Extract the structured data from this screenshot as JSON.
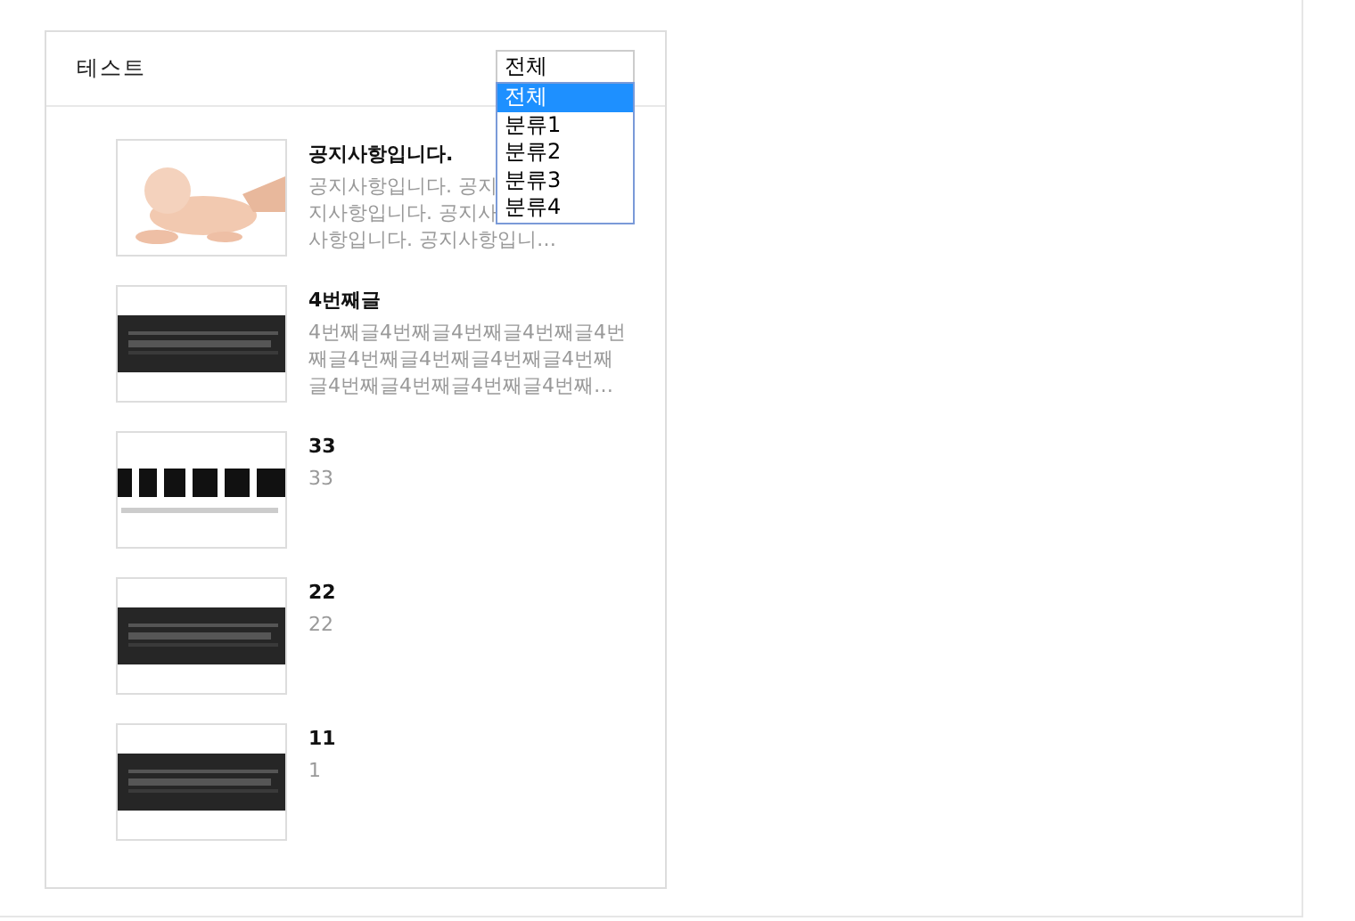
{
  "board": {
    "title": "테스트",
    "category_select": {
      "value": "전체",
      "expanded": true,
      "options": [
        {
          "label": "전체",
          "selected": true
        },
        {
          "label": "분류1",
          "selected": false
        },
        {
          "label": "분류2",
          "selected": false
        },
        {
          "label": "분류3",
          "selected": false
        },
        {
          "label": "분류4",
          "selected": false
        }
      ]
    },
    "posts": [
      {
        "title": "공지사항입니다.",
        "lines": [
          "공지사항입니다. 공지",
          "지사항입니다. 공지사",
          "사항입니다. 공지사항입니…"
        ]
      },
      {
        "title": "4번째글",
        "lines": [
          "4번째글4번째글4번째글4번째글4번",
          "째글4번째글4번째글4번째글4번째",
          "글4번째글4번째글4번째글4번째…"
        ]
      },
      {
        "title": "33",
        "lines": [
          "33"
        ]
      },
      {
        "title": "22",
        "lines": [
          "22"
        ]
      },
      {
        "title": "11",
        "lines": [
          "1"
        ]
      }
    ]
  }
}
